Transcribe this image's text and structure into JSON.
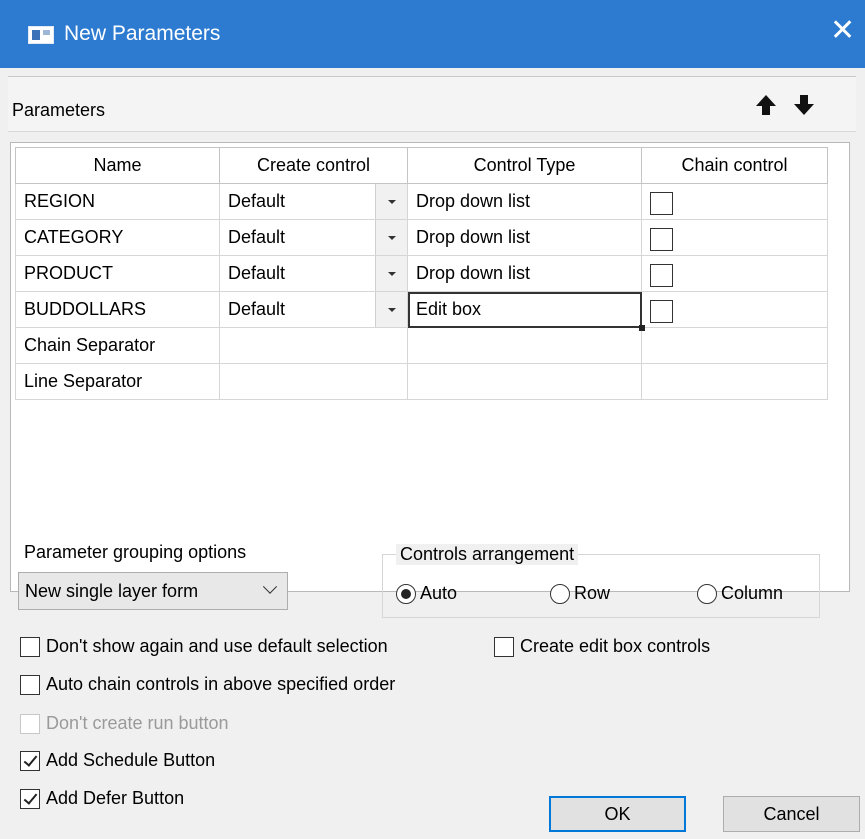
{
  "window": {
    "title": "New Parameters",
    "close_glyph": "✕"
  },
  "toolbar": {
    "label": "Parameters",
    "move_up": "arrow-up-icon",
    "move_down": "arrow-down-icon"
  },
  "grid": {
    "headers": [
      "Name",
      "Create control",
      "Control Type",
      "Chain control"
    ],
    "rows": [
      {
        "name": "REGION",
        "create_control": "Default",
        "control_type": "Drop down list",
        "chain": false
      },
      {
        "name": "CATEGORY",
        "create_control": "Default",
        "control_type": "Drop down list",
        "chain": false
      },
      {
        "name": "PRODUCT",
        "create_control": "Default",
        "control_type": "Drop down list",
        "chain": false
      },
      {
        "name": "BUDDOLLARS",
        "create_control": "Default",
        "control_type": "Edit box",
        "chain": false
      },
      {
        "name": "Chain Separator",
        "create_control": "",
        "control_type": "",
        "chain": null
      },
      {
        "name": "Line Separator",
        "create_control": "",
        "control_type": "",
        "chain": null
      }
    ]
  },
  "grouping": {
    "label": "Parameter grouping options",
    "selected": "New single layer form"
  },
  "arrangement": {
    "legend": "Controls arrangement",
    "options": [
      "Auto",
      "Row",
      "Column"
    ],
    "selected": "Auto"
  },
  "options": {
    "dont_show_again": {
      "label": "Don't show again and use default selection",
      "checked": false
    },
    "create_edit_box": {
      "label": "Create edit box controls",
      "checked": false
    },
    "auto_chain": {
      "label": "Auto chain controls in above specified order",
      "checked": false
    },
    "dont_create_run": {
      "label": "Don't create run button",
      "checked": false,
      "disabled": true
    },
    "add_schedule": {
      "label": "Add Schedule Button",
      "checked": true
    },
    "add_defer": {
      "label": "Add Defer Button",
      "checked": true
    }
  },
  "buttons": {
    "ok": "OK",
    "cancel": "Cancel"
  },
  "colors": {
    "titlebar": "#2d7bd1",
    "dialog_bg": "#f0f0f0",
    "default_button_border": "#0078d7"
  }
}
